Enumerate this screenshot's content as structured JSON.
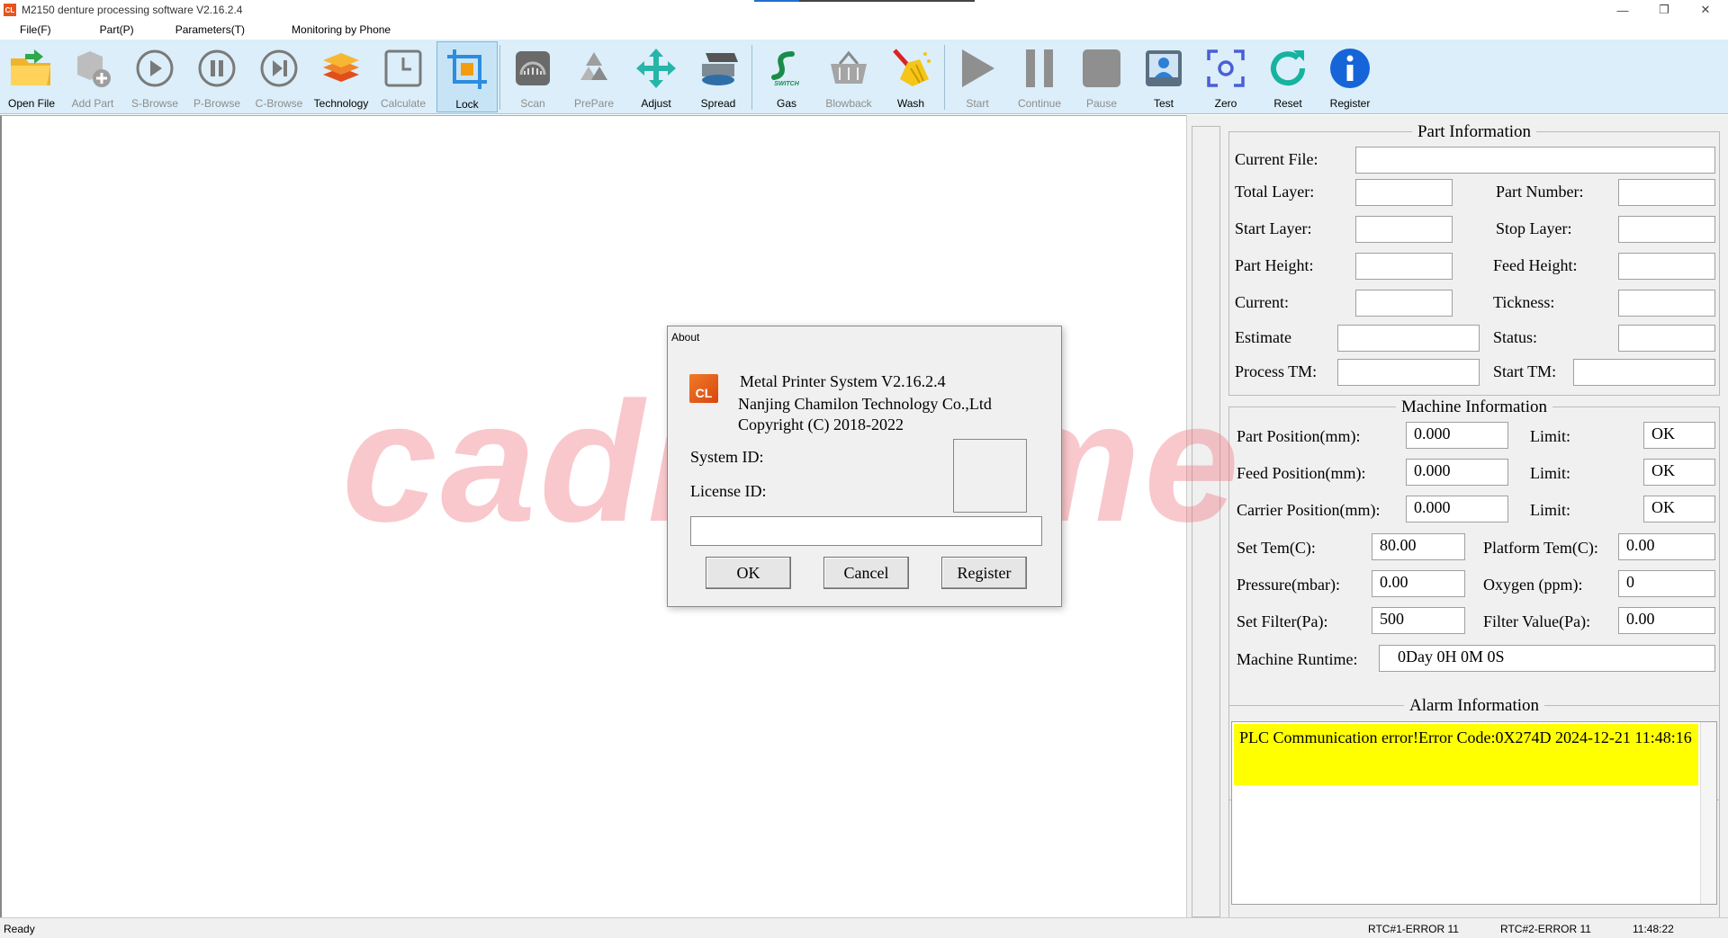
{
  "window": {
    "title": "M2150 denture processing software V2.16.2.4",
    "app_icon_text": "CL"
  },
  "menu": [
    {
      "label": "File(F)"
    },
    {
      "label": "Part(P)"
    },
    {
      "label": "Parameters(T)"
    },
    {
      "label": "Monitoring by Phone"
    }
  ],
  "toolbar": {
    "open_file": "Open File",
    "add_part": "Add Part",
    "s_browse": "S-Browse",
    "p_browse": "P-Browse",
    "c_browse": "C-Browse",
    "technology": "Technology",
    "calculate": "Calculate",
    "lock": "Lock",
    "scan": "Scan",
    "prepare": "PrePare",
    "adjust": "Adjust",
    "spread": "Spread",
    "gas": "Gas",
    "gas_icon_text": "SWITCH",
    "blowback": "Blowback",
    "wash": "Wash",
    "start": "Start",
    "continue": "Continue",
    "pause": "Pause",
    "test": "Test",
    "zero": "Zero",
    "reset": "Reset",
    "register": "Register"
  },
  "watermark": "cadkey.me",
  "part_info": {
    "title": "Part Information",
    "current_file_label": "Current File:",
    "total_layer_label": "Total Layer:",
    "part_number_label": "Part Number:",
    "start_layer_label": "Start Layer:",
    "stop_layer_label": "Stop Layer:",
    "part_height_label": "Part Height:",
    "feed_height_label": "Feed Height:",
    "current_label": "Current:",
    "tickness_label": "Tickness:",
    "estimate_label": "Estimate",
    "status_label": "Status:",
    "process_tm_label": "Process TM:",
    "start_tm_label": "Start TM:"
  },
  "machine_info": {
    "title": "Machine Information",
    "part_position_label": "Part Position(mm):",
    "part_position_value": "0.000",
    "feed_position_label": "Feed Position(mm):",
    "feed_position_value": "0.000",
    "carrier_position_label": "Carrier Position(mm):",
    "carrier_position_value": "0.000",
    "limit_label": "Limit:",
    "limit_part_value": "OK",
    "limit_feed_value": "OK",
    "limit_carrier_value": "OK",
    "set_tem_label": "Set Tem(C):",
    "set_tem_value": "80.00",
    "platform_tem_label": "Platform Tem(C):",
    "platform_tem_value": "0.00",
    "pressure_label": "Pressure(mbar):",
    "pressure_value": "0.00",
    "oxygen_label": "Oxygen (ppm):",
    "oxygen_value": "0",
    "set_filter_label": "Set Filter(Pa):",
    "set_filter_value": "500",
    "filter_value_label": "Filter Value(Pa):",
    "filter_value_value": "0.00",
    "runtime_label": "Machine Runtime:",
    "runtime_value": "0Day 0H 0M 0S"
  },
  "alarm": {
    "title": "Alarm Information",
    "message": "PLC Communication error!Error Code:0X274D 2024-12-21 11:48:16"
  },
  "statusbar": {
    "left": "Ready",
    "rtc1": "RTC#1-ERROR   11",
    "rtc2": "RTC#2-ERROR   11",
    "time": "11:48:22"
  },
  "dialog": {
    "title": "About",
    "icon_text": "CL",
    "product": "Metal Printer System V2.16.2.4",
    "company": "Nanjing Chamilon Technology Co.,Ltd",
    "copyright": "Copyright (C) 2018-2022",
    "system_id_label": "System ID:",
    "license_id_label": "License ID:",
    "ok_label": "OK",
    "cancel_label": "Cancel",
    "register_label": "Register"
  }
}
